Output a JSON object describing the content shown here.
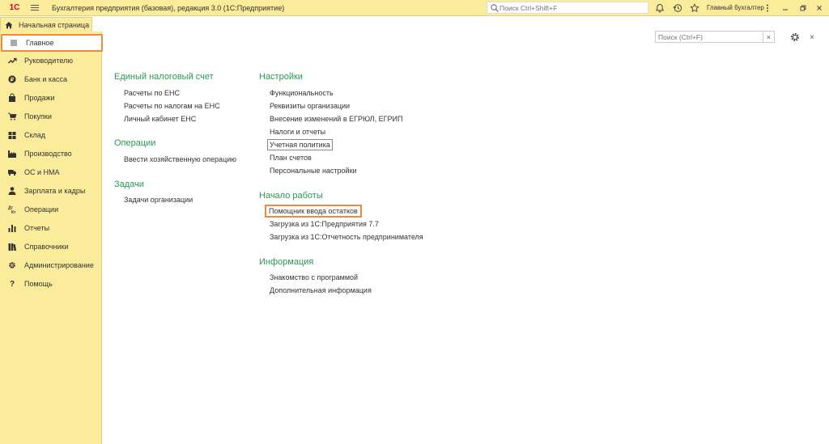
{
  "app": {
    "logo": "1С",
    "title": "Бухгалтерия предприятия (базовая), редакция 3.0  (1С:Предприятие)",
    "search_placeholder": "Поиск Ctrl+Shift+F",
    "user": "Главный бухгалтер"
  },
  "tabs": {
    "home": "Начальная страница"
  },
  "sidebar": {
    "items": [
      {
        "label": "Главное",
        "icon": "menu-icon"
      },
      {
        "label": "Руководителю",
        "icon": "trend-icon"
      },
      {
        "label": "Банк и касса",
        "icon": "coin-icon"
      },
      {
        "label": "Продажи",
        "icon": "bag-icon"
      },
      {
        "label": "Покупки",
        "icon": "cart-icon"
      },
      {
        "label": "Склад",
        "icon": "warehouse-icon"
      },
      {
        "label": "Производство",
        "icon": "factory-icon"
      },
      {
        "label": "ОС и НМА",
        "icon": "truck-icon"
      },
      {
        "label": "Зарплата и кадры",
        "icon": "person-icon"
      },
      {
        "label": "Операции",
        "icon": "dt-kt-icon"
      },
      {
        "label": "Отчеты",
        "icon": "bar-chart-icon"
      },
      {
        "label": "Справочники",
        "icon": "books-icon"
      },
      {
        "label": "Администрирование",
        "icon": "gear-icon"
      },
      {
        "label": "Помощь",
        "icon": "question-icon"
      }
    ]
  },
  "content": {
    "search_placeholder": "Поиск (Ctrl+F)",
    "clear": "×",
    "close": "×",
    "sections": {
      "ens": {
        "title": "Единый налоговый счет",
        "links": [
          "Расчеты по ЕНС",
          "Расчеты по налогам на ЕНС",
          "Личный кабинет ЕНС"
        ]
      },
      "ops": {
        "title": "Операции",
        "links": [
          "Ввести хозяйственную операцию"
        ]
      },
      "tasks": {
        "title": "Задачи",
        "links": [
          "Задачи организации"
        ]
      },
      "settings": {
        "title": "Настройки",
        "links": [
          "Функциональность",
          "Реквизиты организации",
          "Внесение изменений в ЕГРЮЛ, ЕГРИП",
          "Налоги и отчеты",
          "Учетная политика",
          "План счетов",
          "Персональные настройки"
        ]
      },
      "start": {
        "title": "Начало работы",
        "links": [
          "Помощник ввода остатков",
          "Загрузка из 1С:Предприятия 7.7",
          "Загрузка из 1С:Отчетность предпринимателя"
        ]
      },
      "info": {
        "title": "Информация",
        "links": [
          "Знакомство с программой",
          "Дополнительная информация"
        ]
      }
    }
  },
  "colors": {
    "panel": "#fbec9c",
    "section_title": "#279a52",
    "highlight": "#ee8b3a"
  }
}
